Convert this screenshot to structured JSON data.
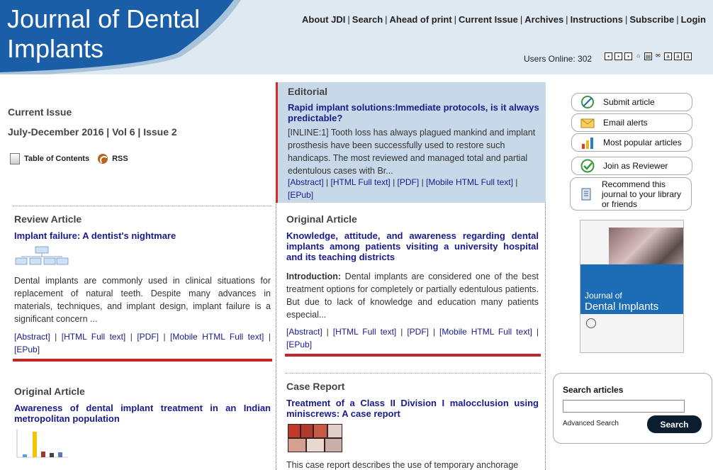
{
  "header": {
    "logo_line1": "Journal of Dental",
    "logo_line2": "Implants",
    "nav": [
      "About JDI",
      "Search",
      "Ahead of print",
      "Current Issue",
      "Archives",
      "Instructions",
      "Subscribe",
      "Login"
    ],
    "users_online": "Users Online: 302"
  },
  "left": {
    "current_issue": "Current Issue",
    "issue_label": "July-December 2016 | Vol 6 | Issue 2",
    "toc": "Table of Contents",
    "rss": "RSS"
  },
  "editorial": {
    "section": "Editorial",
    "title": "Rapid implant solutions:Immediate protocols, is it always predictable?",
    "body": "[INLINE:1] Tooth loss has always plagued mankind and implant prosthesis have been successfully used to restore such handicaps. The most reviewed and managed total and partial edentulous cases with Br...",
    "links": [
      "[Abstract]",
      "[HTML Full text]",
      "[PDF]",
      "[Mobile HTML Full text]",
      "[EPub]"
    ]
  },
  "review": {
    "section": "Review Article",
    "title": "Implant failure: A dentist's nightmare",
    "body": "Dental implants are commonly used in clinical situations for replacement of natural teeth. Despite many advances in materials, techniques, and implant design, implant failure is a significant concern ...",
    "links": [
      "[Abstract]",
      "[HTML Full text]",
      "[PDF]",
      "[Mobile HTML Full text]",
      "[EPub]"
    ]
  },
  "original1": {
    "section": "Original Article",
    "title": "Knowledge, attitude, and awareness regarding dental implants among patients visiting a university hospital and its teaching districts",
    "intro_label": "Introduction:",
    "body": " Dental implants are considered one of the best treatment options for completely or partially edentulous patients. But due to lack of knowledge and education many patients especial...",
    "links": [
      "[Abstract]",
      "[HTML Full text]",
      "[PDF]",
      "[Mobile HTML Full text]",
      "[EPub]"
    ]
  },
  "original2": {
    "section": "Original Article",
    "title": "Awareness of dental implant treatment in an Indian metropolitan population"
  },
  "case": {
    "section": "Case Report",
    "title": "Treatment of a Class II Division I malocclusion using miniscrews: A case report",
    "body": "This case report describes the use of temporary anchorage"
  },
  "sidebar": {
    "submit": "Submit article",
    "email": "Email alerts",
    "popular": "Most popular articles",
    "reviewer": "Join as Reviewer",
    "recommend_l1": "Recommend this",
    "recommend_l2": "journal to your library",
    "recommend_l3": "or friends",
    "cover_l1": "Journal of",
    "cover_l2": "Dental Implants"
  },
  "search": {
    "label": "Search articles",
    "advanced": "Advanced Search",
    "button": "Search"
  },
  "colors": {
    "header_blue": "#1b5ea8",
    "accent_red": "#c0272d",
    "editorial_bg": "#c7d9e8",
    "link_blue": "#1a1a8a"
  }
}
